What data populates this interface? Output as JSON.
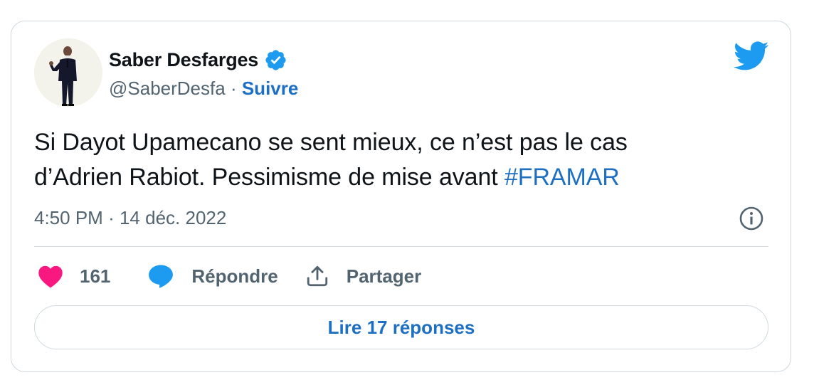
{
  "author": {
    "name": "Saber Desfarges",
    "handle": "@SaberDesfa",
    "separator": "·",
    "follow_label": "Suivre",
    "verified": true,
    "avatar_icon": "person-in-suit-avatar"
  },
  "tweet": {
    "text_line1": "Si Dayot Upamecano se sent mieux, ce n’est pas le cas",
    "text_line2_prefix": "d’Adrien Rabiot. Pessimisme de mise avant ",
    "hashtag": "#FRAMAR",
    "time": "4:50 PM",
    "date_separator": "·",
    "date": "14 déc. 2022"
  },
  "actions": {
    "like_count": "161",
    "reply_label": "Répondre",
    "share_label": "Partager"
  },
  "read_replies_label": "Lire 17 réponses",
  "icons": {
    "brand": "twitter-bird-icon",
    "verified": "verified-badge-icon",
    "info": "info-icon",
    "like": "heart-icon",
    "reply": "speech-bubble-icon",
    "share": "share-upload-icon"
  },
  "colors": {
    "accent": "#1d6fc4",
    "twitter_blue": "#1d9bf0",
    "like_pink": "#f91880",
    "text_primary": "#0f1419",
    "text_secondary": "#536471",
    "border": "#cfd9de"
  }
}
